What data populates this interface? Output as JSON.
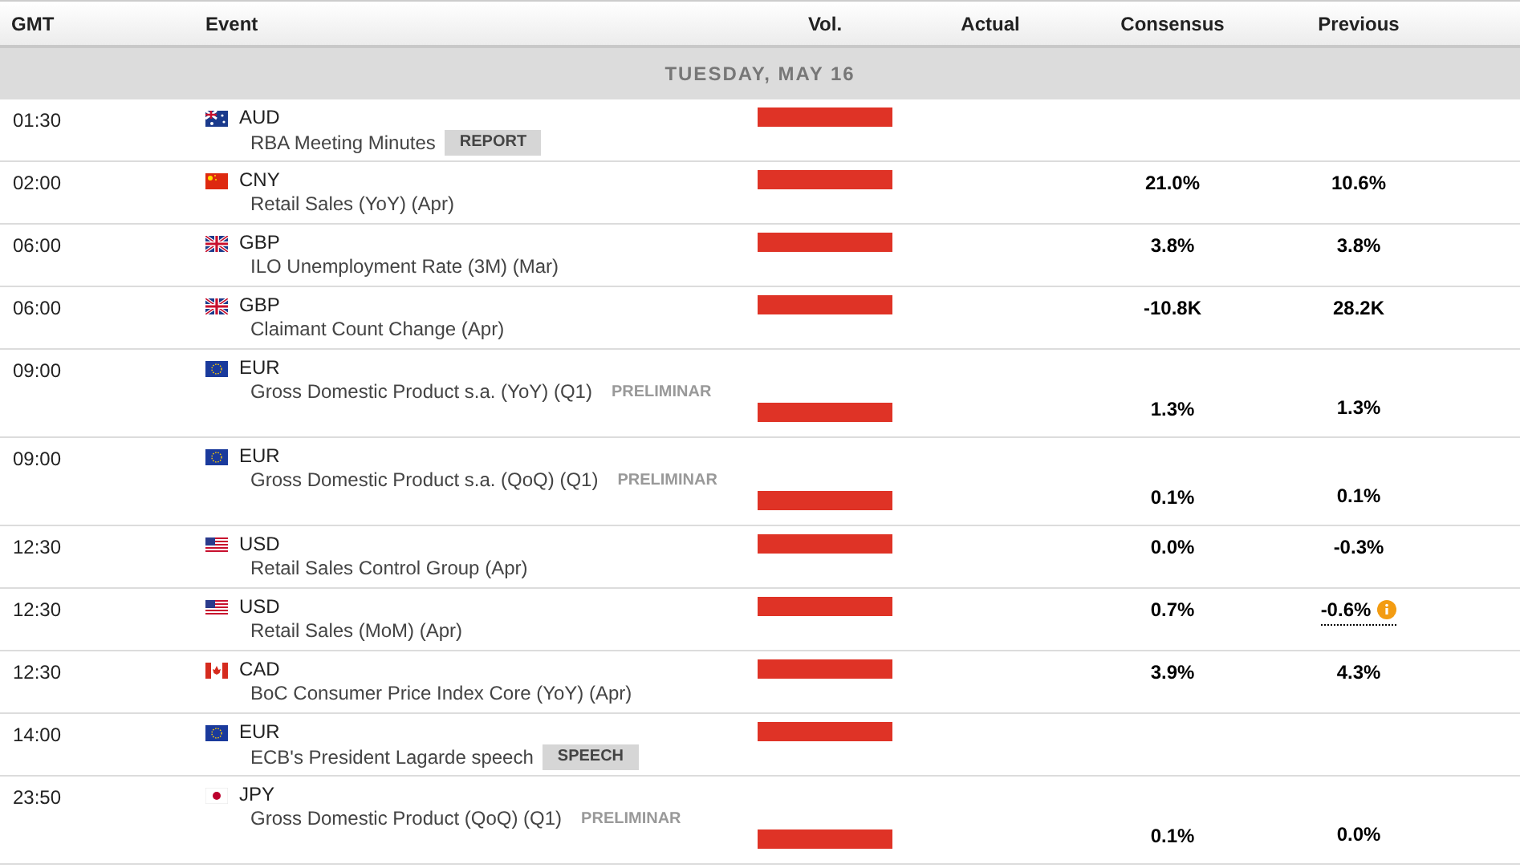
{
  "columns": {
    "time": "GMT",
    "event": "Event",
    "volatility": "Vol.",
    "actual": "Actual",
    "consensus": "Consensus",
    "previous": "Previous"
  },
  "date": "TUESDAY, MAY 16",
  "rows": [
    {
      "time": "01:30",
      "flag": {
        "kind": "au"
      },
      "currency": "AUD",
      "event": "RBA Meeting Minutes",
      "tag": {
        "kind": "badge",
        "text": "REPORT"
      },
      "volatility": {
        "kind": "high"
      }
    },
    {
      "time": "02:00",
      "flag": {
        "kind": "cn"
      },
      "currency": "CNY",
      "event": "Retail Sales (YoY) (Apr)",
      "volatility": {
        "kind": "high"
      },
      "consensus": "21.0%",
      "previous": "10.6%",
      "previous_revised": false
    },
    {
      "time": "06:00",
      "flag": {
        "kind": "gb"
      },
      "currency": "GBP",
      "event": "ILO Unemployment Rate (3M) (Mar)",
      "volatility": {
        "kind": "high"
      },
      "consensus": "3.8%",
      "previous": "3.8%",
      "previous_revised": false
    },
    {
      "time": "06:00",
      "flag": {
        "kind": "gb"
      },
      "currency": "GBP",
      "event": "Claimant Count Change (Apr)",
      "volatility": {
        "kind": "high"
      },
      "consensus": "-10.8K",
      "previous": "28.2K",
      "previous_revised": false
    },
    {
      "time": "09:00",
      "flag": {
        "kind": "eu"
      },
      "currency": "EUR",
      "event": "Gross Domestic Product s.a. (YoY) (Q1)",
      "tag": {
        "kind": "preliminary",
        "text": "PRELIMINAR"
      },
      "volatility": {
        "kind": "high"
      },
      "consensus": "1.3%",
      "previous": "1.3%",
      "previous_revised": false
    },
    {
      "time": "09:00",
      "flag": {
        "kind": "eu"
      },
      "currency": "EUR",
      "event": "Gross Domestic Product s.a. (QoQ) (Q1)",
      "tag": {
        "kind": "preliminary",
        "text": "PRELIMINAR"
      },
      "volatility": {
        "kind": "high"
      },
      "consensus": "0.1%",
      "previous": "0.1%",
      "previous_revised": false
    },
    {
      "time": "12:30",
      "flag": {
        "kind": "us"
      },
      "currency": "USD",
      "event": "Retail Sales Control Group (Apr)",
      "volatility": {
        "kind": "high"
      },
      "consensus": "0.0%",
      "previous": "-0.3%",
      "previous_revised": false
    },
    {
      "time": "12:30",
      "flag": {
        "kind": "us"
      },
      "currency": "USD",
      "event": "Retail Sales (MoM) (Apr)",
      "volatility": {
        "kind": "high"
      },
      "consensus": "0.7%",
      "previous": "-0.6%",
      "previous_revised": true
    },
    {
      "time": "12:30",
      "flag": {
        "kind": "ca"
      },
      "currency": "CAD",
      "event": "BoC Consumer Price Index Core (YoY) (Apr)",
      "volatility": {
        "kind": "high"
      },
      "consensus": "3.9%",
      "previous": "4.3%",
      "previous_revised": false
    },
    {
      "time": "14:00",
      "flag": {
        "kind": "eu"
      },
      "currency": "EUR",
      "event": "ECB's President Lagarde speech",
      "tag": {
        "kind": "badge",
        "text": "SPEECH"
      },
      "volatility": {
        "kind": "high"
      }
    },
    {
      "time": "23:50",
      "flag": {
        "kind": "jp"
      },
      "currency": "JPY",
      "event": "Gross Domestic Product (QoQ) (Q1)",
      "tag": {
        "kind": "preliminary",
        "text": "PRELIMINAR"
      },
      "volatility": {
        "kind": "high"
      },
      "consensus": "0.1%",
      "previous": "0.0%",
      "previous_revised": false
    }
  ]
}
